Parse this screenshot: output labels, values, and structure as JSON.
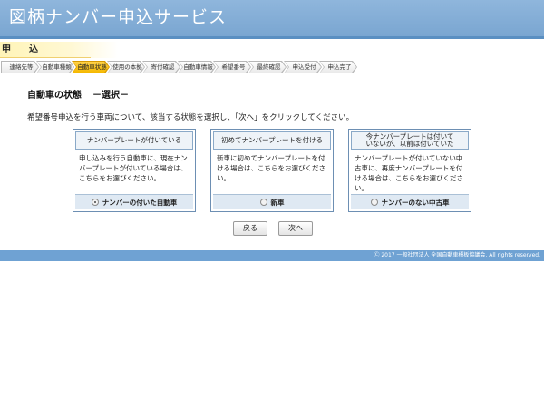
{
  "header": {
    "title": "図柄ナンバー申込サービス"
  },
  "section": {
    "label": "申　　込"
  },
  "steps": [
    {
      "label": "連絡先等",
      "active": false
    },
    {
      "label": "自動車種類",
      "active": false
    },
    {
      "label": "自動車状態",
      "active": true
    },
    {
      "label": "使用の本拠",
      "active": false
    },
    {
      "label": "寄付確認",
      "active": false
    },
    {
      "label": "自動車情報",
      "active": false
    },
    {
      "label": "希望番号",
      "active": false
    },
    {
      "label": "最終確認",
      "active": false
    },
    {
      "label": "申込受付",
      "active": false
    },
    {
      "label": "申込完了",
      "active": false
    }
  ],
  "page": {
    "title": "自動車の状態",
    "subtitle": "－選択－",
    "instruction": "希望番号申込を行う車両について、該当する状態を選択し、「次へ」をクリックしてください。"
  },
  "options": [
    {
      "heading": "ナンバープレートが付いている",
      "description": "申し込みを行う自動車に、現在ナンバープレートが付いている場合は、こちらをお選びください。",
      "radio_label": "ナンバーの付いた自動車",
      "selected": true
    },
    {
      "heading": "初めてナンバープレートを付ける",
      "description": "新車に初めてナンバープレートを付ける場合は、こちらをお選びください。",
      "radio_label": "新車",
      "selected": false
    },
    {
      "heading_line1": "今ナンバープレートは付いて",
      "heading_line2": "いないが、以前は付いていた",
      "description": "ナンバープレートが付いていない中古車に、再度ナンバープレートを付ける場合は、こちらをお選びください。",
      "radio_label": "ナンバーのない中古車",
      "selected": false
    }
  ],
  "buttons": {
    "back": "戻る",
    "next": "次へ"
  },
  "footer": {
    "copyright": "Ⓒ 2017 一般社団法人 全国自動車標板協議会. All rights reserved."
  },
  "colors": {
    "header": "#7aa6d1",
    "active_step": "#f5b800",
    "card_border": "#6d8fb3",
    "footer": "#6fa2d3"
  }
}
